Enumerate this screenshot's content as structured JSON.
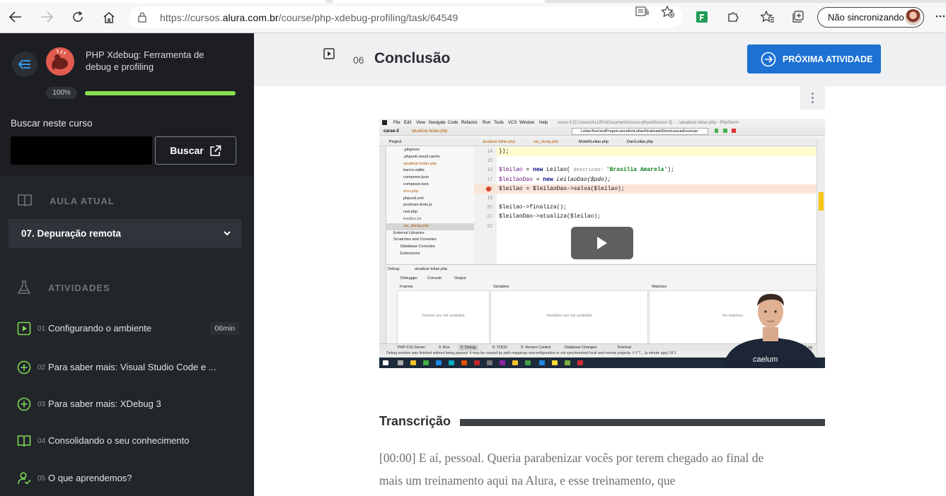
{
  "browser": {
    "url_prefix": "https://cursos.",
    "url_domain": "alura.com.br",
    "url_path": "/course/php-xdebug-profiling/task/64549",
    "sync_label": "Não sincronizando"
  },
  "sidebar": {
    "course_title": "PHP Xdebug: Ferramenta de debug e profiling",
    "progress_label": "100%",
    "progress_value": 1.0,
    "search_label": "Buscar neste curso",
    "search_value": "",
    "search_button": "Buscar",
    "current_lesson_heading": "AULA ATUAL",
    "current_lesson": "07. Depuração remota",
    "activities_heading": "ATIVIDADES",
    "activities": [
      {
        "num": "01",
        "label": "Configurando o ambiente",
        "duration": "06min",
        "icon": "video-play-icon"
      },
      {
        "num": "02",
        "label": "Para saber mais: Visual Studio Code e ...",
        "icon": "plus-circle-icon"
      },
      {
        "num": "03",
        "label": "Para saber mais: XDebug 3",
        "icon": "plus-circle-icon"
      },
      {
        "num": "04",
        "label": "Consolidando o seu conhecimento",
        "icon": "open-book-icon"
      },
      {
        "num": "05",
        "label": "O que aprendemos?",
        "icon": "person-check-icon"
      }
    ]
  },
  "main": {
    "activity_number": "06",
    "activity_title": "Conclusão",
    "next_button": "PRÓXIMA ATIVIDADE",
    "transcript_title": "Transcrição",
    "transcript_text": "[00:00] E aí, pessoal. Queria parabenizar vocês por terem chegado ao final de mais um treinamento aqui na Alura, e esse treinamento, que"
  },
  "video": {
    "menu": [
      "File",
      "Edit",
      "View",
      "Navigate",
      "Code",
      "Refactor",
      "Run",
      "Tools",
      "VCS",
      "Window",
      "Help"
    ],
    "window_title": "curso-3 [C:\\Users\\ALURA\\Documents\\curso-phpunit\\curso-3] - ...\\atualizar-leilao.php - PhpStorm",
    "run_config": "LeilaoTest.testProporLanceEmLeilaoFinalizadoDeveLancarExcecao",
    "project_name": "curso-3",
    "breadcrumb_file": "atualizar-leilao.php",
    "tabs": [
      "atualizar-leilao.php",
      "var_dump.php",
      "Model\\Leilao.php",
      "Dao\\Leilao.php"
    ],
    "project_label": "Project",
    "files": [
      ".gitignore",
      ".phpunit.result.cache",
      "atualizar-leilao.php",
      "banco.sqlite",
      "composer.json",
      "composer.lock",
      "erro.php",
      "phpunit.xml",
      "postman-tests.js",
      "rest.php",
      "testdox.txt",
      "var_dump.php",
      "External Libraries",
      "Scratches and Consoles",
      "Database Consoles",
      "Extensions"
    ],
    "line_numbers": [
      "14",
      "15",
      "16",
      "17",
      "18",
      "19",
      "20",
      "21",
      "22"
    ],
    "code": {
      "l14": "});",
      "l16_var": "$leilao",
      "l16_a": " = ",
      "l16_kw": "new",
      "l16_b": " Leilao( ",
      "l16_hint": "descricao: ",
      "l16_str": "'Brasília Amarela'",
      "l16_c": ");",
      "l17_var": "$leilaoDao",
      "l17_a": " = ",
      "l17_kw": "new",
      "l17_b": " LeilaoDao($pdo);",
      "l18": "$leilao = $leilaoDao->salva($leilao);",
      "l20": "$leilao->finaliza();",
      "l21": "$leilaoDao->atualiza($leilao);"
    },
    "debug_label": "Debug:",
    "debug_config": "atualizar-leilao.php",
    "debug_tabs": [
      "Debugger",
      "Console",
      "Output"
    ],
    "frames_label": "Frames",
    "frames_empty": "Frames are not available",
    "variables_label": "Variables",
    "variables_empty": "Variables are not available",
    "watches_label": "Watches",
    "watches_empty": "No watches",
    "status_tabs": [
      "PHP-CGI Server",
      "4: Run",
      "5: Debug",
      "6: TODO",
      "9: Version Control",
      "Database Changes",
      "Terminal",
      "Event Log"
    ],
    "status_message": "Debug session was finished without being paused: It may be caused by path mappings misconfiguration or not synchronized local and remote projects. // // T... (a minute ago)  18:1",
    "brand": "caelum"
  },
  "colors": {
    "sidebar_bg": "#22252a",
    "accent_green": "#86e04f",
    "primary_blue": "#1d71d3",
    "header_bg": "#eef0f2"
  }
}
